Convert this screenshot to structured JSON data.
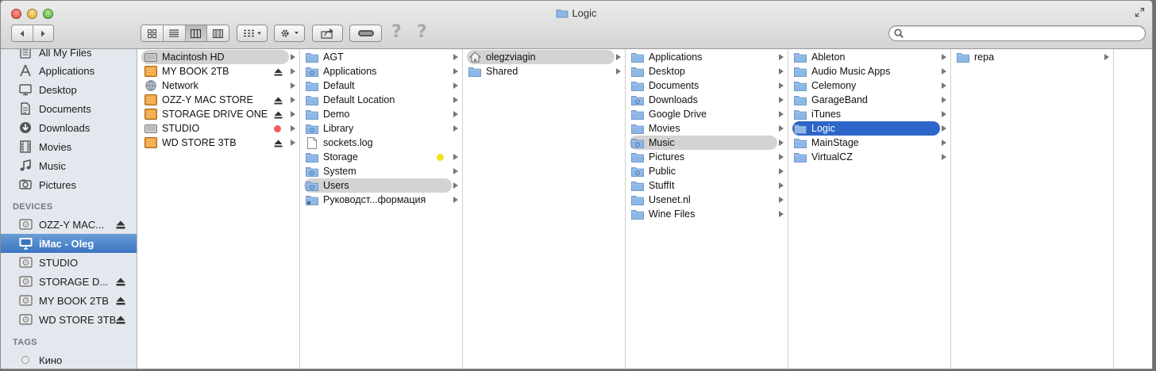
{
  "window": {
    "title": "Logic"
  },
  "search": {
    "value": "",
    "placeholder": ""
  },
  "sidebar": {
    "favorites": [
      {
        "label": "All My Files",
        "icon": "all-files-icon"
      },
      {
        "label": "Applications",
        "icon": "applications-icon"
      },
      {
        "label": "Desktop",
        "icon": "desktop-icon"
      },
      {
        "label": "Documents",
        "icon": "documents-icon"
      },
      {
        "label": "Downloads",
        "icon": "downloads-icon"
      },
      {
        "label": "Movies",
        "icon": "movies-icon"
      },
      {
        "label": "Music",
        "icon": "music-icon"
      },
      {
        "label": "Pictures",
        "icon": "pictures-icon"
      }
    ],
    "devices_header": "DEVICES",
    "devices": [
      {
        "label": "OZZ-Y MAC...",
        "eject": true
      },
      {
        "label": "iMac - Oleg",
        "eject": false,
        "selected": true
      },
      {
        "label": "STUDIO",
        "eject": false
      },
      {
        "label": "STORAGE D...",
        "eject": true
      },
      {
        "label": "MY BOOK 2TB",
        "eject": true
      },
      {
        "label": "WD STORE 3TB",
        "eject": true
      }
    ],
    "tags_header": "TAGS",
    "tags": [
      {
        "label": "Кино"
      }
    ]
  },
  "columns": [
    [
      {
        "label": "Macintosh HD",
        "icon": "hard-drive-icon",
        "hl": "gray"
      },
      {
        "label": "MY BOOK 2TB",
        "icon": "external-drive-icon",
        "eject": true
      },
      {
        "label": "Network",
        "icon": "network-icon"
      },
      {
        "label": "OZZ-Y MAC STORE",
        "icon": "external-drive-icon",
        "eject": true
      },
      {
        "label": "STORAGE DRIVE ONE",
        "icon": "external-drive-icon",
        "eject": true
      },
      {
        "label": "STUDIO",
        "icon": "hard-drive-icon",
        "tag": "#f25c5c"
      },
      {
        "label": "WD STORE 3TB",
        "icon": "external-drive-icon",
        "eject": true
      }
    ],
    [
      {
        "label": "AGT",
        "icon": "folder-icon"
      },
      {
        "label": "Applications",
        "icon": "applications-folder-icon"
      },
      {
        "label": "Default",
        "icon": "folder-icon"
      },
      {
        "label": "Default Location",
        "icon": "folder-icon"
      },
      {
        "label": "Demo",
        "icon": "folder-icon"
      },
      {
        "label": "Library",
        "icon": "library-folder-icon"
      },
      {
        "label": "sockets.log",
        "icon": "document-icon",
        "noarrow": true
      },
      {
        "label": "Storage",
        "icon": "folder-icon",
        "tag": "#f2e21e"
      },
      {
        "label": "System",
        "icon": "system-folder-icon"
      },
      {
        "label": "Users",
        "icon": "users-folder-icon",
        "hl": "gray"
      },
      {
        "label": "Руководст...формация",
        "icon": "alias-folder-icon"
      }
    ],
    [
      {
        "label": "olegzviagin",
        "icon": "home-icon",
        "hl": "gray"
      },
      {
        "label": "Shared",
        "icon": "folder-icon"
      }
    ],
    [
      {
        "label": "Applications",
        "icon": "folder-icon"
      },
      {
        "label": "Desktop",
        "icon": "folder-icon"
      },
      {
        "label": "Documents",
        "icon": "folder-icon"
      },
      {
        "label": "Downloads",
        "icon": "downloads-folder-icon"
      },
      {
        "label": "Google Drive",
        "icon": "folder-icon"
      },
      {
        "label": "Movies",
        "icon": "folder-icon"
      },
      {
        "label": "Music",
        "icon": "music-folder-icon",
        "hl": "gray"
      },
      {
        "label": "Pictures",
        "icon": "folder-icon"
      },
      {
        "label": "Public",
        "icon": "public-folder-icon"
      },
      {
        "label": "StuffIt",
        "icon": "folder-icon"
      },
      {
        "label": "Usenet.nl",
        "icon": "folder-icon"
      },
      {
        "label": "Wine Files",
        "icon": "folder-icon"
      }
    ],
    [
      {
        "label": "Ableton",
        "icon": "folder-icon"
      },
      {
        "label": "Audio Music Apps",
        "icon": "folder-icon"
      },
      {
        "label": "Celemony",
        "icon": "folder-icon"
      },
      {
        "label": "GarageBand",
        "icon": "folder-icon"
      },
      {
        "label": "iTunes",
        "icon": "folder-icon"
      },
      {
        "label": "Logic",
        "icon": "folder-icon",
        "hl": "blue"
      },
      {
        "label": "MainStage",
        "icon": "folder-icon"
      },
      {
        "label": "VirtualCZ",
        "icon": "folder-icon"
      }
    ],
    [
      {
        "label": "repa",
        "icon": "folder-icon"
      }
    ]
  ],
  "colors": {
    "selection_blue": "#2d66c8",
    "sidebar_bg": "#e3e8ee",
    "folder_blue": "#8db7e6"
  }
}
